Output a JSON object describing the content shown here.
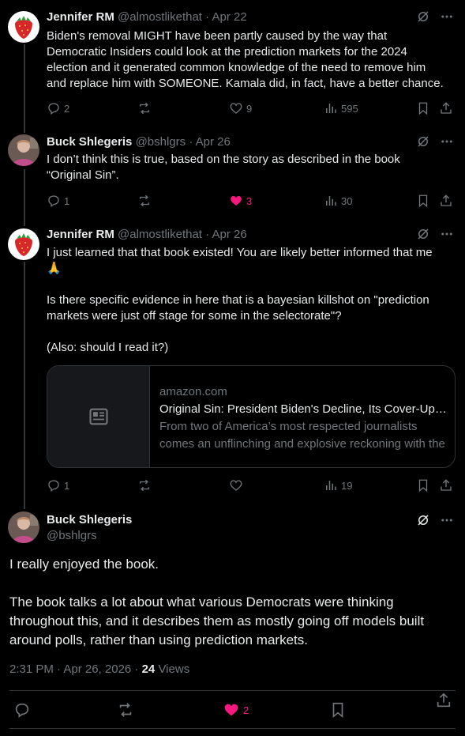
{
  "tweets": [
    {
      "name": "Jennifer RM",
      "handle": "@almostlikethat",
      "date": "· Apr 22",
      "lines": [
        "Biden's removal MIGHT have been partly caused by the way that",
        "Democratic Insiders could look at the prediction markets for the 2024",
        "election and it generated common knowledge of the need to remove him",
        "and replace him with SOMEONE. Kamala did, in fact, have a better chance."
      ],
      "replies": "2",
      "reposts": "",
      "likes": "9",
      "views": "595"
    },
    {
      "name": "Buck Shlegeris",
      "handle": "@bshlgrs",
      "date": "· Apr 26",
      "lines": [
        "I don’t think this is true, based on the story as described in the book",
        "“Original Sin”."
      ],
      "replies": "1",
      "reposts": "",
      "likes": "3",
      "views": "30"
    },
    {
      "name": "Jennifer RM",
      "handle": "@almostlikethat",
      "date": "· Apr 26",
      "lines": [
        "I just learned that that book existed! You are likely better informed that me",
        "🙏",
        "",
        "Is there specific evidence in here that is a bayesian killshot on \"prediction",
        "markets were just off stage for some in the selectorate\"?",
        "",
        "(Also: should I read it?)"
      ],
      "card": {
        "domain": "amazon.com",
        "title": "Original Sin: President Biden's Decline, Its Cover-Up, and His Disastrous Choice to Run Again",
        "description": "From two of America’s most respected journalists comes an unflinching and explosive reckoning with the cover-up"
      },
      "replies": "1",
      "reposts": "",
      "likes": "",
      "views": "19"
    }
  ],
  "main": {
    "name": "Buck Shlegeris",
    "handle": "@bshlgrs",
    "paragraphs": [
      "I really enjoyed the book.",
      "",
      "The book talks a lot about what various Democrats were thinking",
      "throughout this, and it describes them as mostly going off models built",
      "around polls, rather than using prediction markets."
    ],
    "timestamp": "2:31 PM · Apr 26, 2026 · ",
    "views_count": "24",
    "views_label": " Views",
    "likes": "2"
  },
  "colors": {
    "like_active": "#f91880",
    "muted": "#71767b",
    "text": "#e7e9ea",
    "border": "#2f3336"
  },
  "icons": [
    "strawberry-avatar",
    "profile-photo-avatar",
    "grok-icon",
    "more-icon",
    "reply-icon",
    "repost-icon",
    "like-icon",
    "views-icon",
    "bookmark-icon",
    "share-icon",
    "article-icon"
  ]
}
